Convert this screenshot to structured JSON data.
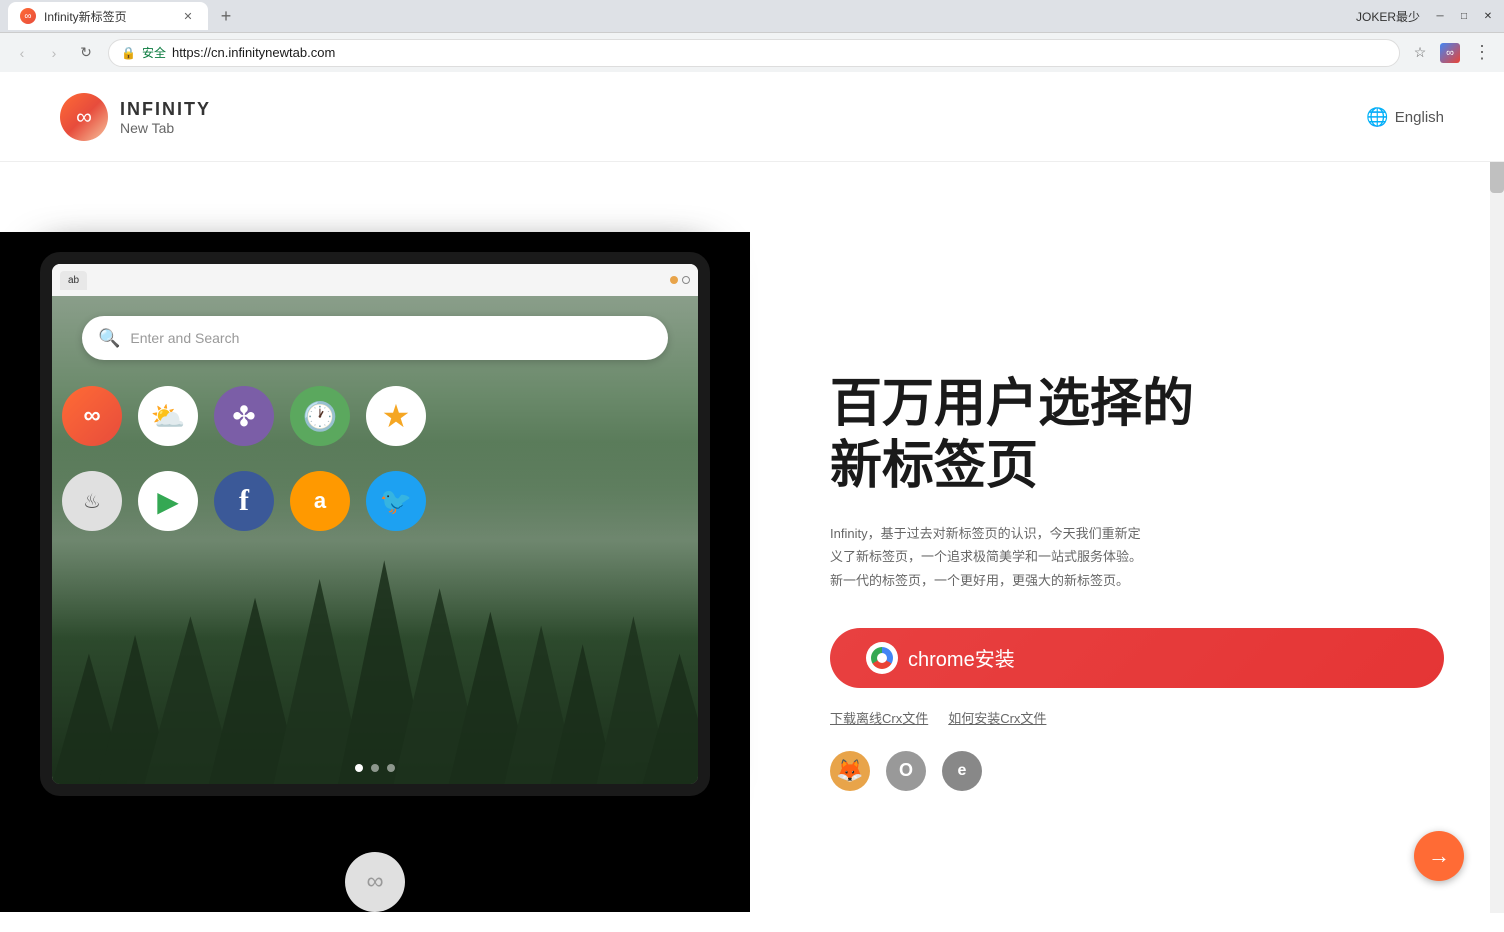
{
  "browser": {
    "tab_title": "Infinity新标签页",
    "tab_favicon": "∞",
    "url": "https://cn.infinitynewtab.com",
    "secure_label": "安全",
    "username": "JOKER最少",
    "new_tab_label": "+",
    "back_disabled": true,
    "forward_disabled": true
  },
  "header": {
    "logo_symbol": "∞",
    "brand": "INFINITY",
    "sub": "New Tab",
    "lang_icon": "🌐",
    "lang_label": "English"
  },
  "hero": {
    "title_line1": "百万用户选择的",
    "title_line2": "新标签页",
    "description": "Infinity，基于过去对新标签页的认识，今天我们重新定义了新标签页，一个追求极简美学和一站式服务体验。新一代的标签页，一个更好用，更强大的新标签页。",
    "install_label": "chrome安装",
    "crx_download": "下载离线Crx文件",
    "crx_install": "如何安装Crx文件"
  },
  "tablet": {
    "search_placeholder": "Enter and Search",
    "pagination": [
      true,
      false,
      false
    ]
  },
  "app_icons": {
    "row1": [
      {
        "name": "infinity",
        "symbol": "∞",
        "color": "#ff6b35"
      },
      {
        "name": "weather",
        "symbol": "⛅",
        "color": "#87ceeb"
      },
      {
        "name": "clover",
        "symbol": "✤",
        "color": "#7b5ea7"
      },
      {
        "name": "clock",
        "symbol": "🕐",
        "color": "#5ba85e"
      },
      {
        "name": "star",
        "symbol": "★",
        "color": "#f5a623"
      }
    ],
    "row2": [
      {
        "name": "steam",
        "symbol": "♨",
        "color": "#e8e8e8"
      },
      {
        "name": "play",
        "symbol": "▶",
        "color": "#fff"
      },
      {
        "name": "facebook",
        "symbol": "f",
        "color": "#3b5998"
      },
      {
        "name": "amazon",
        "symbol": "a",
        "color": "#ff9900"
      },
      {
        "name": "twitter",
        "symbol": "🐦",
        "color": "#1da1f2"
      }
    ]
  },
  "browser_icons": [
    {
      "name": "firefox",
      "symbol": "🦊"
    },
    {
      "name": "opera",
      "symbol": "O"
    },
    {
      "name": "edge",
      "symbol": "e"
    }
  ],
  "scroll_btn": "→"
}
